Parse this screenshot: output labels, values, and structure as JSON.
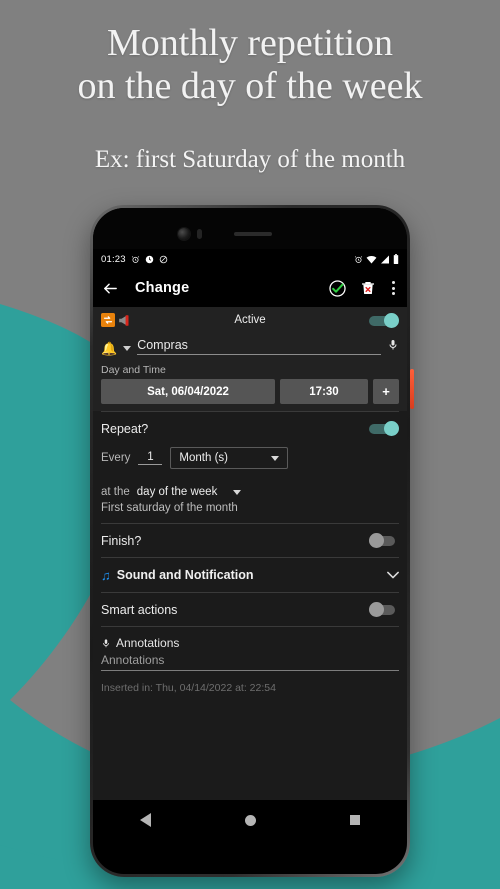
{
  "promo": {
    "headline_line1": "Monthly repetition",
    "headline_line2": "on the day of the week",
    "subline": "Ex: first Saturday of the month",
    "bg_color": "#808080",
    "accent_color": "#2fa09b"
  },
  "status_bar": {
    "time": "01:23",
    "left_icons": [
      "alarm-icon",
      "clock-icon",
      "do-not-disturb-icon"
    ],
    "right_icons": [
      "alarm-icon",
      "wifi-icon",
      "signal-icon",
      "battery-icon"
    ]
  },
  "app_bar": {
    "back_icon": "back-arrow-icon",
    "title": "Change",
    "confirm_icon": "check-circle-icon",
    "delete_icon": "delete-icon",
    "overflow_icon": "kebab-menu-icon",
    "confirm_color": "#2ecc40",
    "delete_color": "#e02020"
  },
  "form": {
    "active_row": {
      "repeat_icon": "repeat-icon",
      "megaphone_icon": "megaphone-icon",
      "label": "Active",
      "toggle": "on"
    },
    "title_row": {
      "bell_icon": "bell-icon",
      "dropdown_icon": "chevron-down-icon",
      "value": "Compras",
      "mic_icon": "microphone-icon"
    },
    "day_time": {
      "section_label": "Day and Time",
      "date_button": "Sat, 06/04/2022",
      "time_button": "17:30",
      "add_button": "+"
    },
    "repeat": {
      "label": "Repeat?",
      "toggle": "on",
      "every_label": "Every",
      "every_value": "1",
      "unit_value": "Month (s)",
      "at_the_label": "at the",
      "mode_value": "day of the week",
      "description": "First saturday of the month"
    },
    "finish": {
      "label": "Finish?",
      "toggle": "off"
    },
    "sound": {
      "icon": "music-note-icon",
      "label": "Sound and Notification",
      "expand_icon": "chevron-down-icon",
      "icon_color": "#1e90f0"
    },
    "smart_actions": {
      "label": "Smart actions",
      "toggle": "off"
    },
    "annotations": {
      "mic_icon": "microphone-icon",
      "label": "Annotations",
      "placeholder": "Annotations",
      "value": ""
    },
    "inserted": "Inserted in: Thu, 04/14/2022 at: 22:54"
  },
  "nav_bar": {
    "back": "back-triangle-icon",
    "home": "home-circle-icon",
    "recents": "recents-square-icon"
  }
}
